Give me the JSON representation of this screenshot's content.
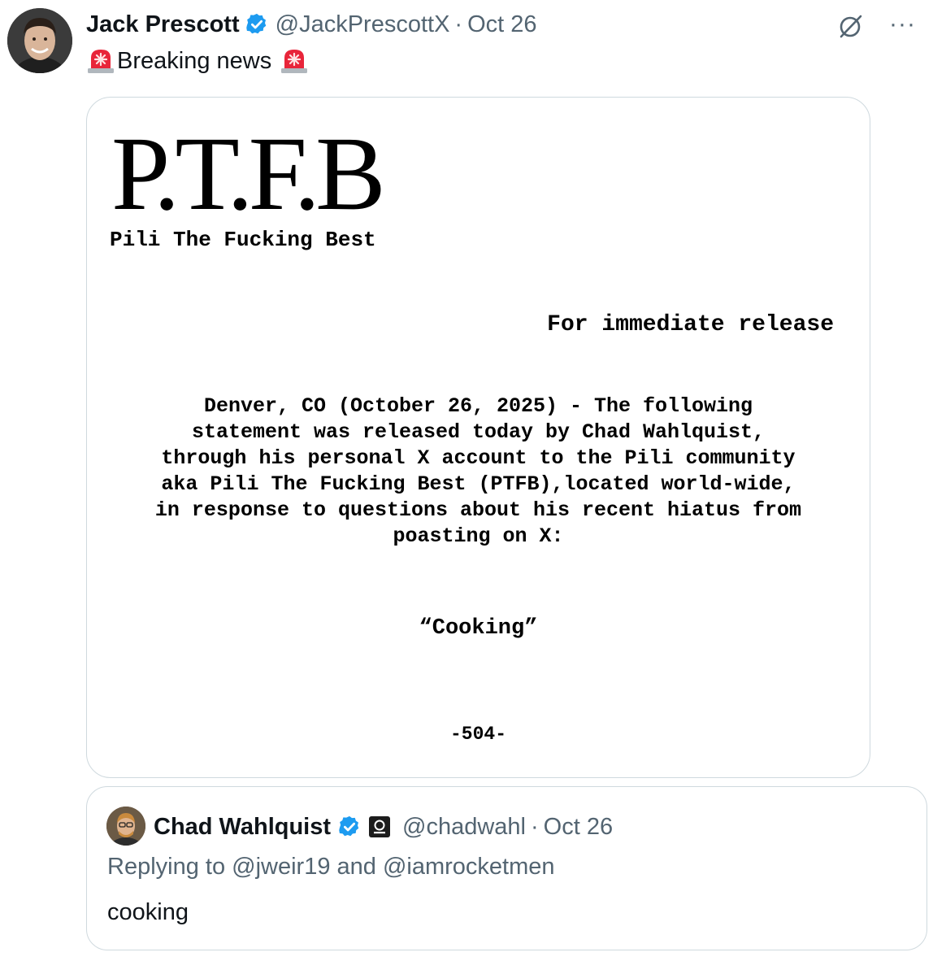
{
  "tweet": {
    "author": {
      "name": "Jack Prescott",
      "handle": "@JackPrescottX",
      "separator": "·",
      "date": "Oct 26",
      "verified": true
    },
    "text": "Breaking news",
    "text_emoji_icon": "police-siren-icon",
    "header_icons": [
      "grok-icon",
      "more-options-icon"
    ],
    "more_label": "···"
  },
  "media": {
    "logo": "P.T.F.B",
    "subtitle": "Pili The Fucking Best",
    "release_label": "For immediate release",
    "body_lines": [
      "Denver, CO (October 26, 2025) - The following",
      "statement was released today by Chad Wahlquist,",
      "through his personal X account to the Pili community",
      "aka Pili The Fucking Best (PTFB),located world-wide,",
      "in response to questions about his recent hiatus from",
      "poasting on X:"
    ],
    "quote": "“Cooking”",
    "end_mark": "-504-"
  },
  "quoted_tweet": {
    "author": {
      "name": "Chad Wahlquist",
      "handle": "@chadwahl",
      "separator": "·",
      "date": "Oct 26",
      "verified": true,
      "affiliate_badge_icon": "affiliate-badge-icon"
    },
    "replying_to": "Replying to @jweir19 and @iamrocketmen",
    "text": "cooking"
  },
  "colors": {
    "text_primary": "#0f1419",
    "text_secondary": "#536471",
    "verified_blue": "#1d9bf0",
    "border": "#cfd9de",
    "siren_red": "#e8253a"
  }
}
